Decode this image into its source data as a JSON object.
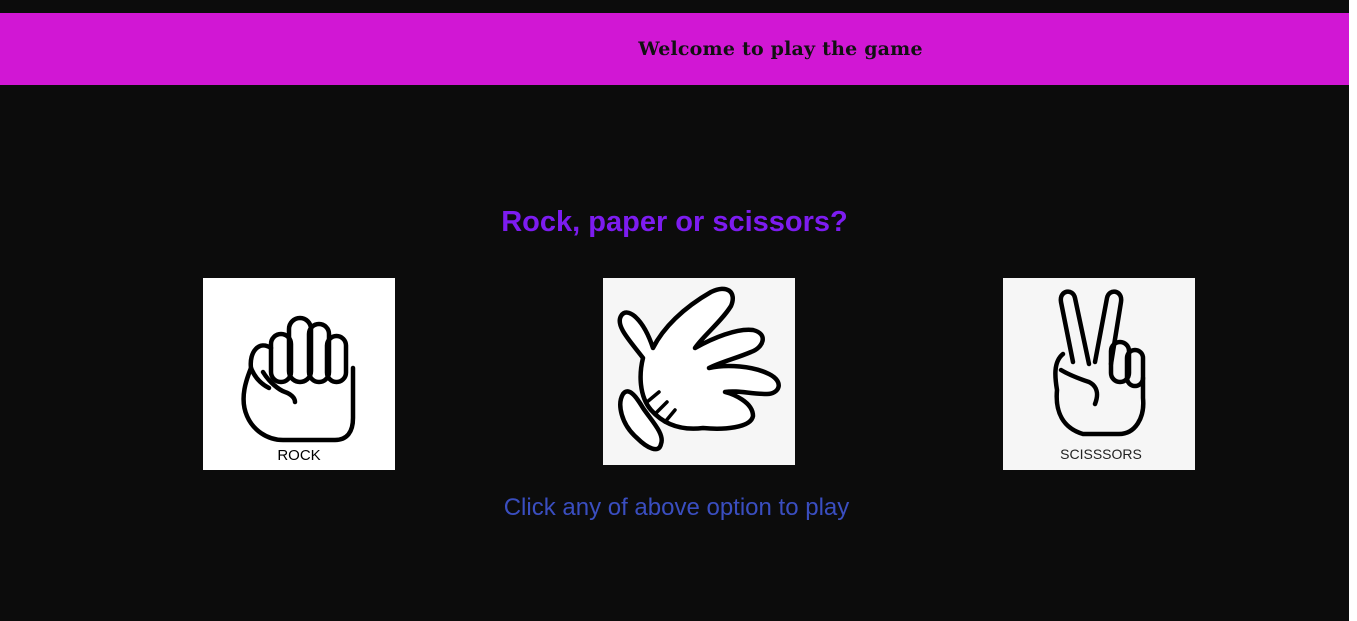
{
  "header": {
    "title": "Welcome to play the game"
  },
  "game": {
    "question": "Rock, paper or scissors?",
    "choices": [
      {
        "id": "rock",
        "caption": "ROCK"
      },
      {
        "id": "paper",
        "caption": ""
      },
      {
        "id": "scissors",
        "caption": "SCISSSORS"
      }
    ],
    "hint": "Click any of above option to play"
  },
  "colors": {
    "header_bg": "#d117d4",
    "page_bg": "#0c0c0c",
    "question": "#7d1cf0",
    "hint": "#3a4ec0"
  }
}
